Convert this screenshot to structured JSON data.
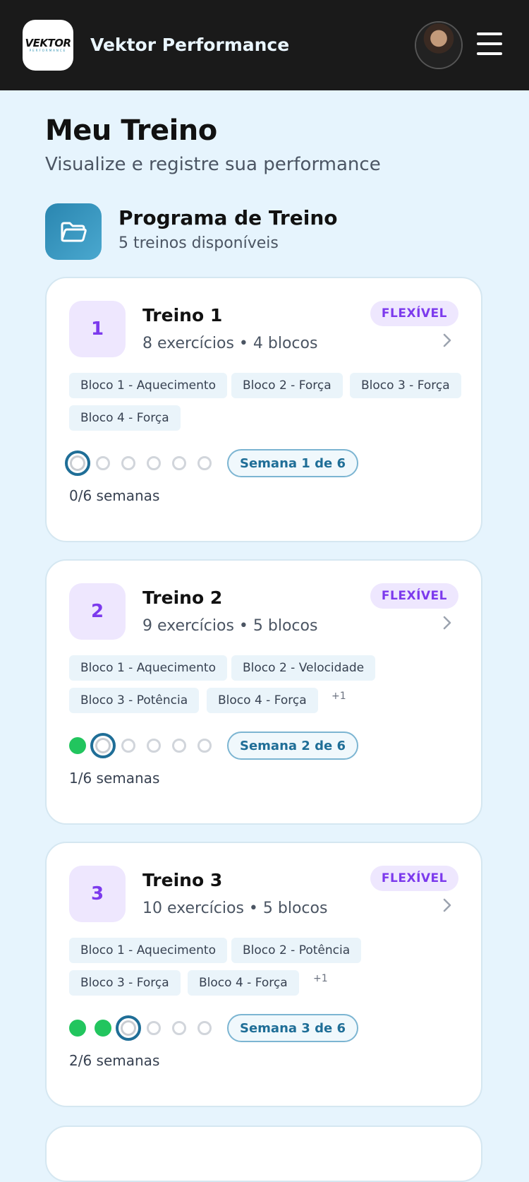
{
  "header": {
    "logo_text": "VEKTOR",
    "logo_sub": "PERFORMANCE",
    "app_title": "Vektor Performance"
  },
  "page": {
    "title": "Meu Treino",
    "subtitle": "Visualize e registre sua performance"
  },
  "program": {
    "title": "Programa de Treino",
    "subtitle": "5 treinos disponíveis"
  },
  "workouts": [
    {
      "number": "1",
      "title": "Treino 1",
      "subtitle": "8 exercícios • 4 blocos",
      "badge": "FLEXÍVEL",
      "chips": [
        "Bloco 1 - Aquecimento",
        "Bloco 2 - Força",
        "Bloco 3 - Força",
        "Bloco 4 - Força"
      ],
      "more": "",
      "weeks_done": 0,
      "weeks_total": 6,
      "week_label": "Semana 1 de 6",
      "progress_text": "0/6 semanas"
    },
    {
      "number": "2",
      "title": "Treino 2",
      "subtitle": "9 exercícios • 5 blocos",
      "badge": "FLEXÍVEL",
      "chips": [
        "Bloco 1 - Aquecimento",
        "Bloco 2 - Velocidade",
        "Bloco 3 - Potência",
        "Bloco 4 - Força"
      ],
      "more": "+1",
      "weeks_done": 1,
      "weeks_total": 6,
      "week_label": "Semana 2 de 6",
      "progress_text": "1/6 semanas"
    },
    {
      "number": "3",
      "title": "Treino 3",
      "subtitle": "10 exercícios • 5 blocos",
      "badge": "FLEXÍVEL",
      "chips": [
        "Bloco 1 - Aquecimento",
        "Bloco 2 - Potência",
        "Bloco 3 - Força",
        "Bloco 4 - Força"
      ],
      "more": "+1",
      "weeks_done": 2,
      "weeks_total": 6,
      "week_label": "Semana 3 de 6",
      "progress_text": "2/6 semanas"
    }
  ]
}
